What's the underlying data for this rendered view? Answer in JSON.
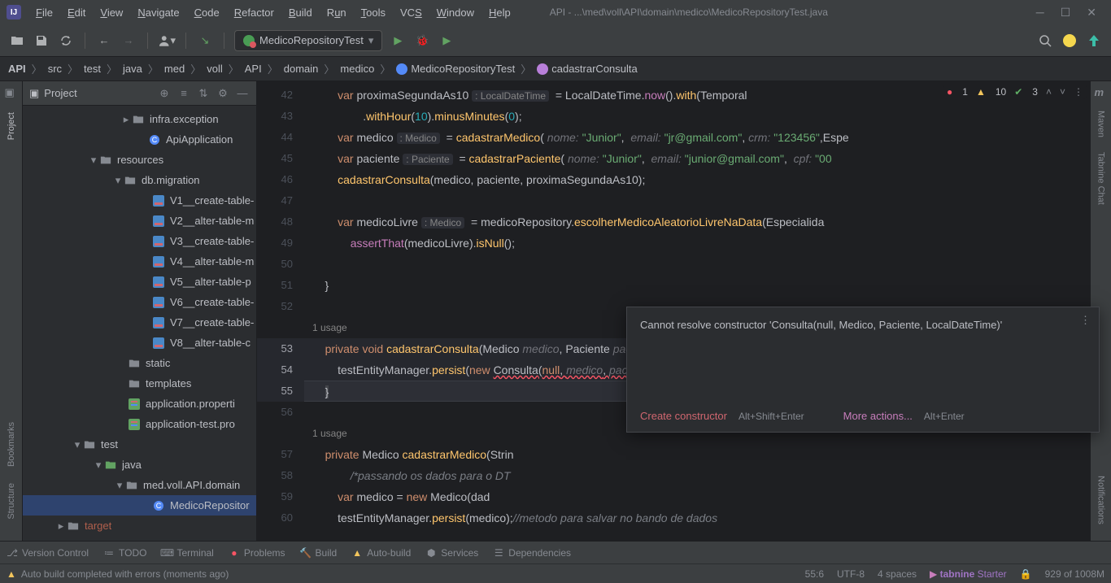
{
  "titlebar": {
    "app_path": "API - ...\\med\\voll\\API\\domain\\medico\\MedicoRepositoryTest.java",
    "menu": [
      "File",
      "Edit",
      "View",
      "Navigate",
      "Code",
      "Refactor",
      "Build",
      "Run",
      "Tools",
      "VCS",
      "Window",
      "Help"
    ]
  },
  "toolbar": {
    "run_config": "MedicoRepositoryTest"
  },
  "breadcrumbs": [
    "API",
    "src",
    "test",
    "java",
    "med",
    "voll",
    "API",
    "domain",
    "medico",
    "MedicoRepositoryTest",
    "cadastrarConsulta"
  ],
  "inspections": {
    "errors": "1",
    "warnings": "10",
    "weak": "3"
  },
  "project_header": {
    "title": "Project"
  },
  "tree": [
    {
      "ind": 120,
      "ch": "▸",
      "icon": "folder",
      "cls": "fold-gray",
      "label": "infra.exception"
    },
    {
      "ind": 140,
      "ch": "",
      "icon": "class",
      "cls": "fold-blue",
      "label": "ApiApplication"
    },
    {
      "ind": 80,
      "ch": "▾",
      "icon": "folder",
      "cls": "fold-gray",
      "label": "resources"
    },
    {
      "ind": 110,
      "ch": "▾",
      "icon": "folder",
      "cls": "fold-gray",
      "label": "db.migration"
    },
    {
      "ind": 145,
      "ch": "",
      "icon": "sql",
      "cls": "",
      "label": "V1__create-table-"
    },
    {
      "ind": 145,
      "ch": "",
      "icon": "sql",
      "cls": "",
      "label": "V2__alter-table-m"
    },
    {
      "ind": 145,
      "ch": "",
      "icon": "sql",
      "cls": "",
      "label": "V3__create-table-"
    },
    {
      "ind": 145,
      "ch": "",
      "icon": "sql",
      "cls": "",
      "label": "V4__alter-table-m"
    },
    {
      "ind": 145,
      "ch": "",
      "icon": "sql",
      "cls": "",
      "label": "V5__alter-table-p"
    },
    {
      "ind": 145,
      "ch": "",
      "icon": "sql",
      "cls": "",
      "label": "V6__create-table-"
    },
    {
      "ind": 145,
      "ch": "",
      "icon": "sql",
      "cls": "",
      "label": "V7__create-table-"
    },
    {
      "ind": 145,
      "ch": "",
      "icon": "sql",
      "cls": "",
      "label": "V8__alter-table-c"
    },
    {
      "ind": 115,
      "ch": "",
      "icon": "folder",
      "cls": "fold-gray",
      "label": "static"
    },
    {
      "ind": 115,
      "ch": "",
      "icon": "folder",
      "cls": "fold-gray",
      "label": "templates"
    },
    {
      "ind": 115,
      "ch": "",
      "icon": "prop",
      "cls": "",
      "label": "application.properti"
    },
    {
      "ind": 115,
      "ch": "",
      "icon": "prop",
      "cls": "",
      "label": "application-test.pro"
    },
    {
      "ind": 60,
      "ch": "▾",
      "icon": "folder",
      "cls": "fold-gray",
      "label": "test"
    },
    {
      "ind": 86,
      "ch": "▾",
      "icon": "folder",
      "cls": "fold-green",
      "label": "java"
    },
    {
      "ind": 112,
      "ch": "▾",
      "icon": "folder",
      "cls": "fold-gray",
      "label": "med.voll.API.domain"
    },
    {
      "ind": 145,
      "ch": "",
      "icon": "class",
      "cls": "fold-blue",
      "label": "MedicoRepositor",
      "sel": true
    },
    {
      "ind": 40,
      "ch": "▸",
      "icon": "folder",
      "cls": "fold-gray",
      "label": "target",
      "excl": true
    }
  ],
  "leftrail": [
    "Project",
    "Bookmarks",
    "Structure"
  ],
  "rightrail": [
    "Maven",
    "Tabnine Chat",
    "Notifications"
  ],
  "editor": {
    "lines": [
      {
        "n": "42",
        "txt": "        <span class='kw'>var</span> <span class='id'>proximaSegundaAs10</span> <span class='hint'>: LocalDateTime</span>  = <span class='cls'>LocalDateTime</span>.<span class='fnc'>now</span>().<span class='yl'>with</span>(<span class='cls'>Temporal</span>"
      },
      {
        "n": "43",
        "txt": "                .<span class='yl'>withHour</span>(<span class='num'>10</span>).<span class='yl'>minusMinutes</span>(<span class='num'>0</span>);"
      },
      {
        "n": "44",
        "txt": "        <span class='kw'>var</span> <span class='id'>medico</span> <span class='hint'>: Medico</span>  = <span class='yl'>cadastrarMedico</span>( <span class='param'>nome:</span> <span class='str'>\"Junior\"</span>,  <span class='param'>email:</span> <span class='str'>\"jr@gmail.com\"</span>, <span class='param'>crm:</span> <span class='str'>\"123456\"</span>,<span class='cls'>Espe</span>"
      },
      {
        "n": "45",
        "txt": "        <span class='kw'>var</span> <span class='id'>paciente</span> <span class='hint'>: Paciente</span>  = <span class='yl'>cadastrarPaciente</span>( <span class='param'>nome:</span> <span class='str'>\"Junior\"</span>,  <span class='param'>email:</span> <span class='str'>\"junior@gmail.com\"</span>,  <span class='param'>cpf:</span> <span class='str'>\"00</span>"
      },
      {
        "n": "46",
        "txt": "        <span class='yl'>cadastrarConsulta</span>(medico, paciente, proximaSegundaAs10);"
      },
      {
        "n": "47",
        "txt": ""
      },
      {
        "n": "48",
        "txt": "        <span class='kw'>var</span> <span class='id'>medicoLivre</span> <span class='hint'>: Medico</span>  = <span class='id'>medicoRepository</span>.<span class='yl'>escolherMedicoAleatorioLivreNaData</span>(<span class='cls'>Especialida</span>"
      },
      {
        "n": "49",
        "txt": "            <span class='fnc'>assertThat</span>(medicoLivre).<span class='yl'>isNull</span>();"
      },
      {
        "n": "50",
        "txt": ""
      },
      {
        "n": "51",
        "txt": "    }"
      },
      {
        "n": "52",
        "txt": ""
      },
      {
        "usage": "1 usage"
      },
      {
        "n": "53",
        "txt": "    <span class='kw'>private</span> <span class='kw'>void</span> <span class='yl'>cadastrarConsulta</span>(<span class='cls'>Medico</span> <span class='param'>medico</span>, <span class='cls'>Paciente</span> <span class='param'>paciente</span>, <span class='cls'>LocalDateTime</span> <span class='param'>data</span>)<span style='background:#43454a'>{</span>",
        "hl": true
      },
      {
        "n": "54",
        "txt": "        <span class='id'>testEntityManager</span>.<span class='yl'>persist</span>(<span class='kw'>new</span> <span class='err-underline'><span class='cls'>Consulta</span>(<span class='kw'>null</span>, <span class='param'>medico</span>, <span class='param'>paciente</span>,<span class='param'>data</span>)</span>);",
        "hl": true
      },
      {
        "n": "55",
        "txt": "    <span style='background:#43454a'>}</span>",
        "cur": true
      },
      {
        "n": "56",
        "txt": ""
      },
      {
        "usage": "1 usage"
      },
      {
        "n": "57",
        "txt": "    <span class='kw'>private</span> <span class='cls'>Medico</span> <span class='yl'>cadastrarMedico</span>(<span class='cls'>Strin</span>"
      },
      {
        "n": "58",
        "txt": "            <span class='cmt'>/*passando os dados para o DT</span>"
      },
      {
        "n": "59",
        "txt": "        <span class='kw'>var</span> <span class='id'>medico</span> = <span class='kw'>new</span> <span class='cls'>Medico</span>(<span class='id'>dad</span>"
      },
      {
        "n": "60",
        "txt": "        <span class='id'>testEntityManager</span>.<span class='yl'>persist</span>(medico);<span class='cmt'>//metodo para salvar no bando de dados</span>"
      }
    ]
  },
  "popup": {
    "message": "Cannot resolve constructor 'Consulta(null, Medico, Paciente, LocalDateTime)'",
    "action1": "Create constructor",
    "shortcut1": "Alt+Shift+Enter",
    "action2": "More actions...",
    "shortcut2": "Alt+Enter"
  },
  "bottombar": [
    "Version Control",
    "TODO",
    "Terminal",
    "Problems",
    "Build",
    "Auto-build",
    "Services",
    "Dependencies"
  ],
  "statusbar": {
    "message": "Auto build completed with errors (moments ago)",
    "pos": "55:6",
    "encoding": "UTF-8",
    "indent": "4 spaces",
    "tabnine": "tabnine",
    "tn_plan": "Starter",
    "mem": "929 of 1008M"
  }
}
